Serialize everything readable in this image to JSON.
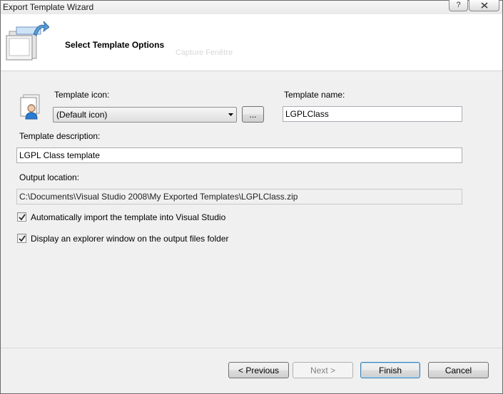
{
  "window": {
    "title": "Export Template Wizard",
    "help_label": "?"
  },
  "header": {
    "title": "Select Template Options",
    "overlay_text": "Capture Fenêtre"
  },
  "form": {
    "icon_label": "Template icon:",
    "icon_value": "(Default icon)",
    "browse_label": "...",
    "name_label": "Template name:",
    "name_value": "LGPLClass",
    "description_label": "Template description:",
    "description_value": "LGPL Class template",
    "output_label": "Output location:",
    "output_value": "C:\\Documents\\Visual Studio 2008\\My Exported Templates\\LGPLClass.zip",
    "auto_import_label": "Automatically import the template into Visual Studio",
    "auto_import_checked": true,
    "explorer_label": "Display an explorer window on the output files folder",
    "explorer_checked": true
  },
  "buttons": {
    "previous": "< Previous",
    "next": "Next >",
    "finish": "Finish",
    "cancel": "Cancel"
  },
  "icons": [
    "wizard-icon",
    "template-icon",
    "dropdown-arrow-icon",
    "checkmark-icon",
    "close-icon"
  ]
}
